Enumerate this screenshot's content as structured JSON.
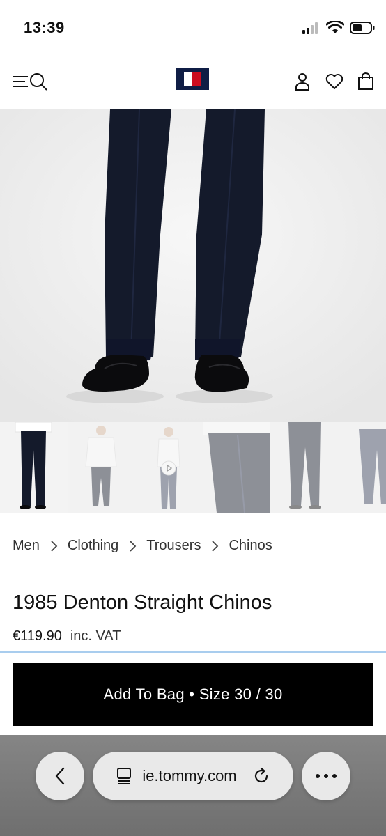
{
  "status_bar": {
    "time": "13:39",
    "icons": [
      "cellular-signal-icon",
      "wifi-icon",
      "battery-icon"
    ]
  },
  "header": {
    "icons": [
      "menu-icon",
      "search-icon",
      "tommy-hilfiger-flag-logo",
      "account-icon",
      "wishlist-heart-icon",
      "shopping-bag-icon"
    ],
    "logo_colors": {
      "navy": "#0f1d45",
      "red": "#cc0c1f",
      "white": "#ffffff"
    }
  },
  "gallery": {
    "thumbnails": [
      {
        "name": "thumb-front-full",
        "selected": true
      },
      {
        "name": "thumb-model-white-sweater",
        "selected": false
      },
      {
        "name": "thumb-video",
        "selected": false,
        "icon": "play-icon"
      },
      {
        "name": "thumb-waist-detail",
        "selected": false
      },
      {
        "name": "thumb-back-view",
        "selected": false
      },
      {
        "name": "thumb-flat-lay",
        "selected": false
      }
    ]
  },
  "breadcrumb": {
    "items": [
      "Men",
      "Clothing",
      "Trousers",
      "Chinos"
    ],
    "separator_icon": "chevron-right-icon"
  },
  "product": {
    "title": "1985 Denton Straight Chinos",
    "price": "€119.90",
    "vat_note": "inc. VAT"
  },
  "cta": {
    "label": "Add To Bag • Size 30 / 30"
  },
  "browser": {
    "url": "ie.tommy.com",
    "icons": [
      "back-icon",
      "reader-tabs-icon",
      "reload-icon",
      "more-icon"
    ]
  },
  "colors": {
    "accent_line": "#a9cdee",
    "cta_bg": "#000000",
    "trousers": "#141a2b"
  }
}
